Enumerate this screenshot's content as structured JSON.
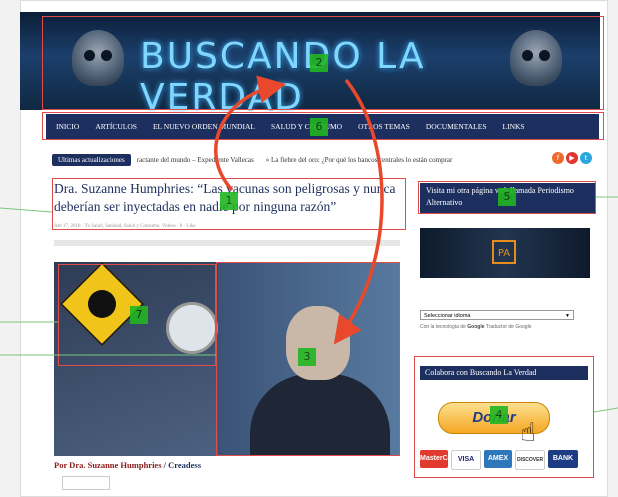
{
  "site": {
    "title": "BUSCANDO LA VERDAD"
  },
  "nav": {
    "items": [
      "INICIO",
      "ARTÍCULOS",
      "EL NUEVO ORDEN MUNDIAL",
      "SALUD Y CONSUMO",
      "OTROS TEMAS",
      "DOCUMENTALES",
      "LINKS"
    ]
  },
  "ticker": {
    "label": "Ultimas actualizaciones",
    "items": [
      "ractante del mundo – Expediente Vallecas",
      "» La fiebre del oro: ¿Por qué los bancos centrales lo están comprar"
    ]
  },
  "social": {
    "facebook_glyph": "f",
    "youtube_glyph": "▶",
    "twitter_glyph": "t"
  },
  "article": {
    "title": "Dra. Suzanne Humphries: “Las vacunas son peligrosas y nunca deberían ser inyectadas en nadie por ninguna razón”",
    "meta": "Abr 17, 2018 · Tu Salud, Sanidad, Salud y Consumo, Videos · 0 · Like",
    "author_prefix": "Por Dra. Suzanne Humphries",
    "author_sep": " / ",
    "author_source": "Creadess"
  },
  "sidebar": {
    "promo_text": "Visita mi otra página web llamada Periodismo Alternativo",
    "logo_badge": "PA",
    "language_select": "Seleccionar idioma",
    "language_credit_prefix": "Con la tecnología de ",
    "language_credit_brand": "Google",
    "language_credit_suffix": " Traductor de Google",
    "collab_title": "Colabora con Buscando La Verdad",
    "donate_label": "Donar",
    "cards": [
      "MasterCard",
      "VISA",
      "AMEX",
      "DISCOVER",
      "BANK"
    ]
  },
  "annotations": [
    "1",
    "2",
    "3",
    "4",
    "5",
    "6",
    "7"
  ],
  "colors": {
    "annotation_box": "#e04b4b",
    "annotation_tag": "#22b522",
    "arrow": "#e8492d",
    "nav_bg": "#1d2f5e",
    "title_blue": "#1d2f5e"
  }
}
